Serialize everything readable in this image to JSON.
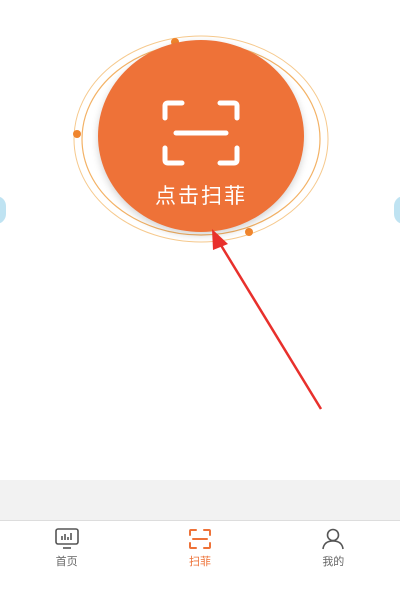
{
  "scan": {
    "label": "点击扫菲",
    "icon": "scan-frame-icon",
    "color": "#ee7238",
    "ring_color": "#f3b266"
  },
  "annotation": {
    "arrow_color": "#e8302c"
  },
  "tabbar": {
    "tabs": [
      {
        "label": "首页",
        "icon": "monitor-chart-icon",
        "active": false
      },
      {
        "label": "扫菲",
        "icon": "scan-frame-icon",
        "active": true
      },
      {
        "label": "我的",
        "icon": "person-icon",
        "active": false
      }
    ],
    "active_color": "#ee7238"
  }
}
